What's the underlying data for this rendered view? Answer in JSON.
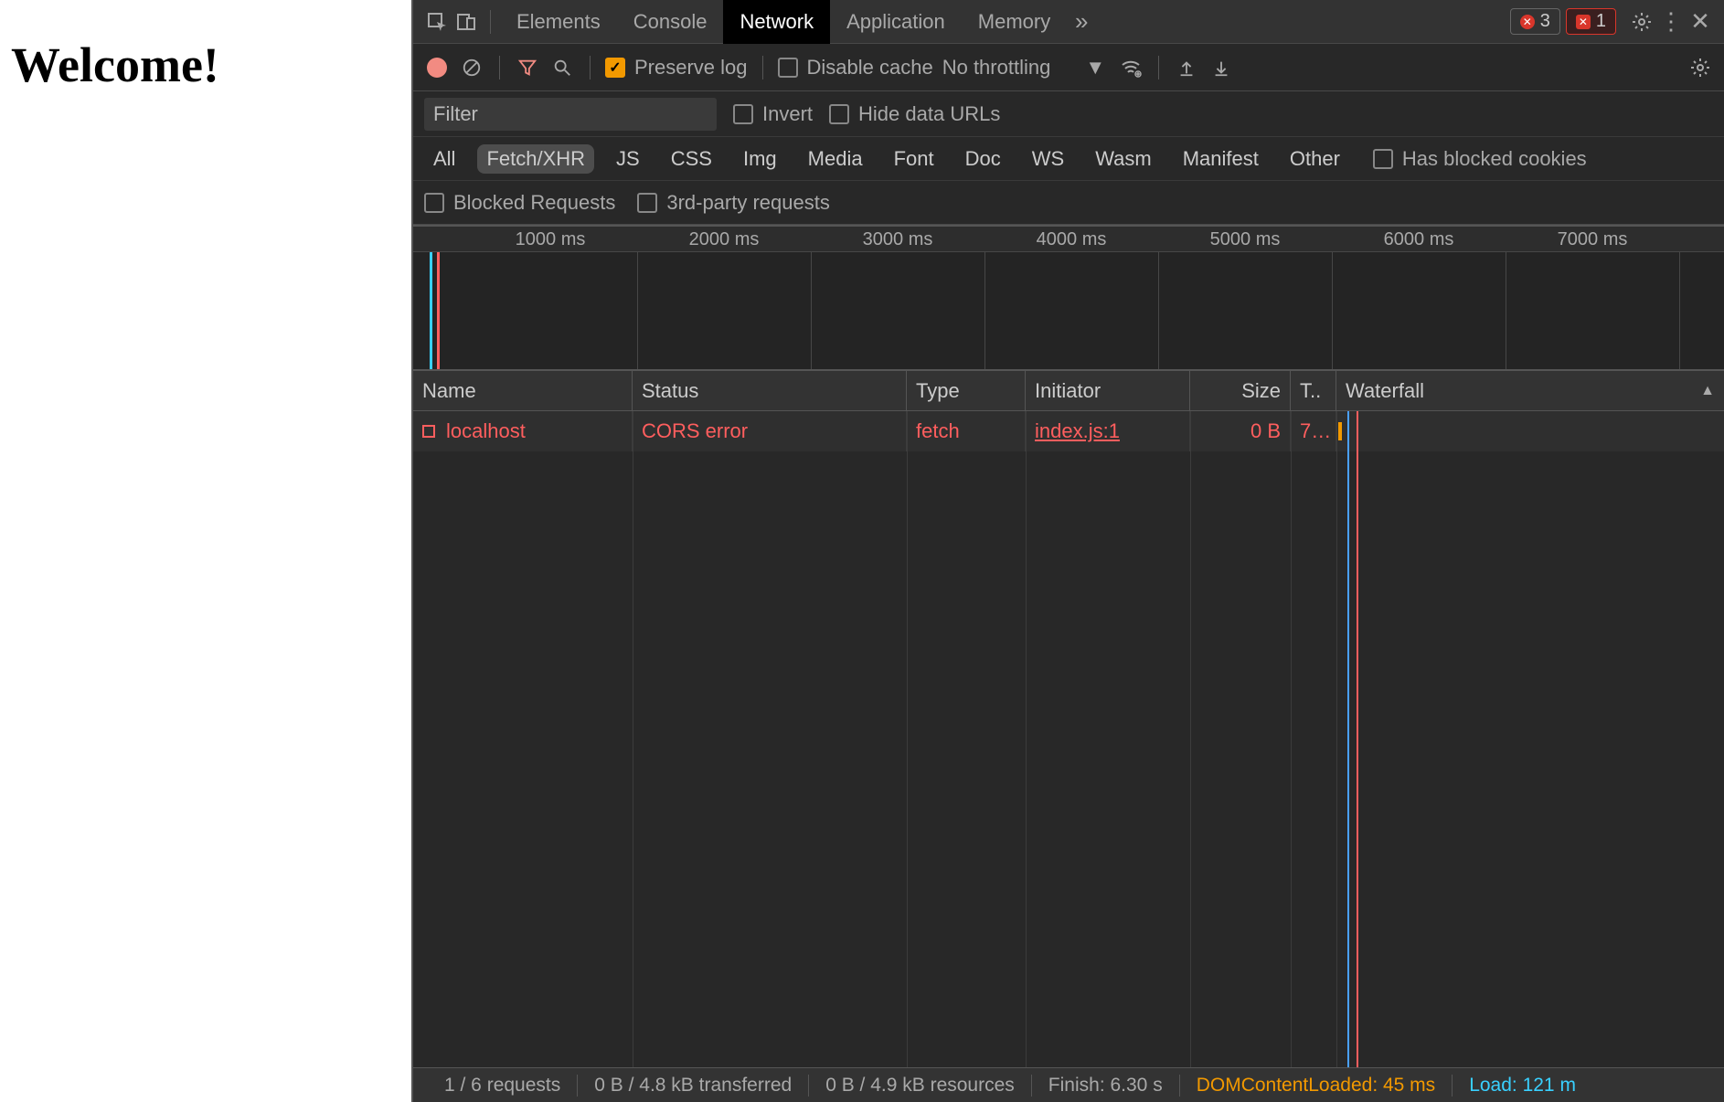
{
  "page": {
    "heading": "Welcome!"
  },
  "tabs": {
    "elements": "Elements",
    "console": "Console",
    "network": "Network",
    "application": "Application",
    "memory": "Memory"
  },
  "badges": {
    "errors": "3",
    "issues": "1"
  },
  "toolbar": {
    "preserve_log": "Preserve log",
    "disable_cache": "Disable cache",
    "throttling": "No throttling"
  },
  "filter": {
    "placeholder": "Filter",
    "invert": "Invert",
    "hide_data_urls": "Hide data URLs"
  },
  "type_filters": {
    "all": "All",
    "fetch_xhr": "Fetch/XHR",
    "js": "JS",
    "css": "CSS",
    "img": "Img",
    "media": "Media",
    "font": "Font",
    "doc": "Doc",
    "ws": "WS",
    "wasm": "Wasm",
    "manifest": "Manifest",
    "other": "Other",
    "has_blocked_cookies": "Has blocked cookies"
  },
  "more_filters": {
    "blocked_requests": "Blocked Requests",
    "third_party": "3rd-party requests"
  },
  "timeline": {
    "ticks": [
      "1000 ms",
      "2000 ms",
      "3000 ms",
      "4000 ms",
      "5000 ms",
      "6000 ms",
      "7000 ms"
    ]
  },
  "columns": {
    "name": "Name",
    "status": "Status",
    "type": "Type",
    "initiator": "Initiator",
    "size": "Size",
    "time": "T..",
    "waterfall": "Waterfall"
  },
  "rows": [
    {
      "name": "localhost",
      "status": "CORS error",
      "type": "fetch",
      "initiator": "index.js:1",
      "size": "0 B",
      "time": "7…"
    }
  ],
  "statusbar": {
    "requests": "1 / 6 requests",
    "transferred": "0 B / 4.8 kB transferred",
    "resources": "0 B / 4.9 kB resources",
    "finish": "Finish: 6.30 s",
    "dcl": "DOMContentLoaded: 45 ms",
    "load": "Load: 121 m"
  }
}
